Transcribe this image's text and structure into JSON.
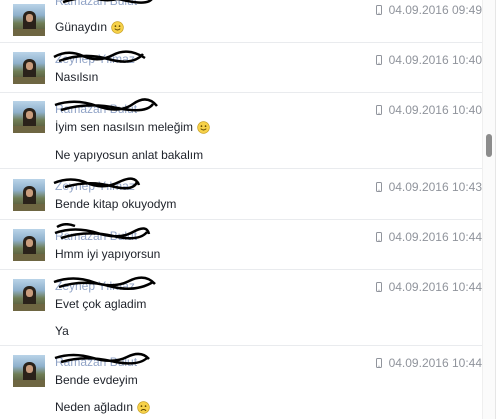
{
  "messages": [
    {
      "sender": "Ramazan Bulut",
      "timestamp": "04.09.2016 09:49",
      "source_icon": "mobile-phone-icon",
      "lines": [
        {
          "text": "Günaydın",
          "emoji": "smiley-emoji-icon"
        }
      ]
    },
    {
      "sender": "Zeynep Yılmaz",
      "timestamp": "04.09.2016 10:40",
      "source_icon": "mobile-phone-icon",
      "lines": [
        {
          "text": "Nasılsın",
          "emoji": ""
        }
      ]
    },
    {
      "sender": "Ramazan Bulut",
      "timestamp": "04.09.2016 10:40",
      "source_icon": "mobile-phone-icon",
      "lines": [
        {
          "text": "İyim sen nasılsın meleğim",
          "emoji": "smiley-emoji-icon"
        },
        {
          "text": "Ne yapıyosun anlat bakalım",
          "emoji": ""
        }
      ]
    },
    {
      "sender": "Zeynep Yılmaz",
      "timestamp": "04.09.2016 10:43",
      "source_icon": "mobile-phone-icon",
      "lines": [
        {
          "text": "Bende kitap okuyodym",
          "emoji": ""
        }
      ]
    },
    {
      "sender": "Ramazan Bulut",
      "timestamp": "04.09.2016 10:44",
      "source_icon": "mobile-phone-icon",
      "lines": [
        {
          "text": "Hmm iyi yapıyorsun",
          "emoji": ""
        }
      ]
    },
    {
      "sender": "Zeynep Yılmaz",
      "timestamp": "04.09.2016 10:44",
      "source_icon": "mobile-phone-icon",
      "lines": [
        {
          "text": "Evet çok agladim",
          "emoji": ""
        },
        {
          "text": "Ya",
          "emoji": ""
        }
      ]
    },
    {
      "sender": "Ramazan Bulut",
      "timestamp": "04.09.2016 10:44",
      "source_icon": "mobile-phone-icon",
      "lines": [
        {
          "text": "Bende evdeyim",
          "emoji": ""
        },
        {
          "text": "Neden ağladın",
          "emoji": "frowning-emoji-icon"
        }
      ]
    }
  ],
  "colors": {
    "sender_link": "#365899",
    "message_text": "#1d2129",
    "timestamp": "#90949c",
    "divider": "#e9ebee",
    "emoji_fill": "#f7d24a",
    "redaction_scribble": "#000000"
  }
}
